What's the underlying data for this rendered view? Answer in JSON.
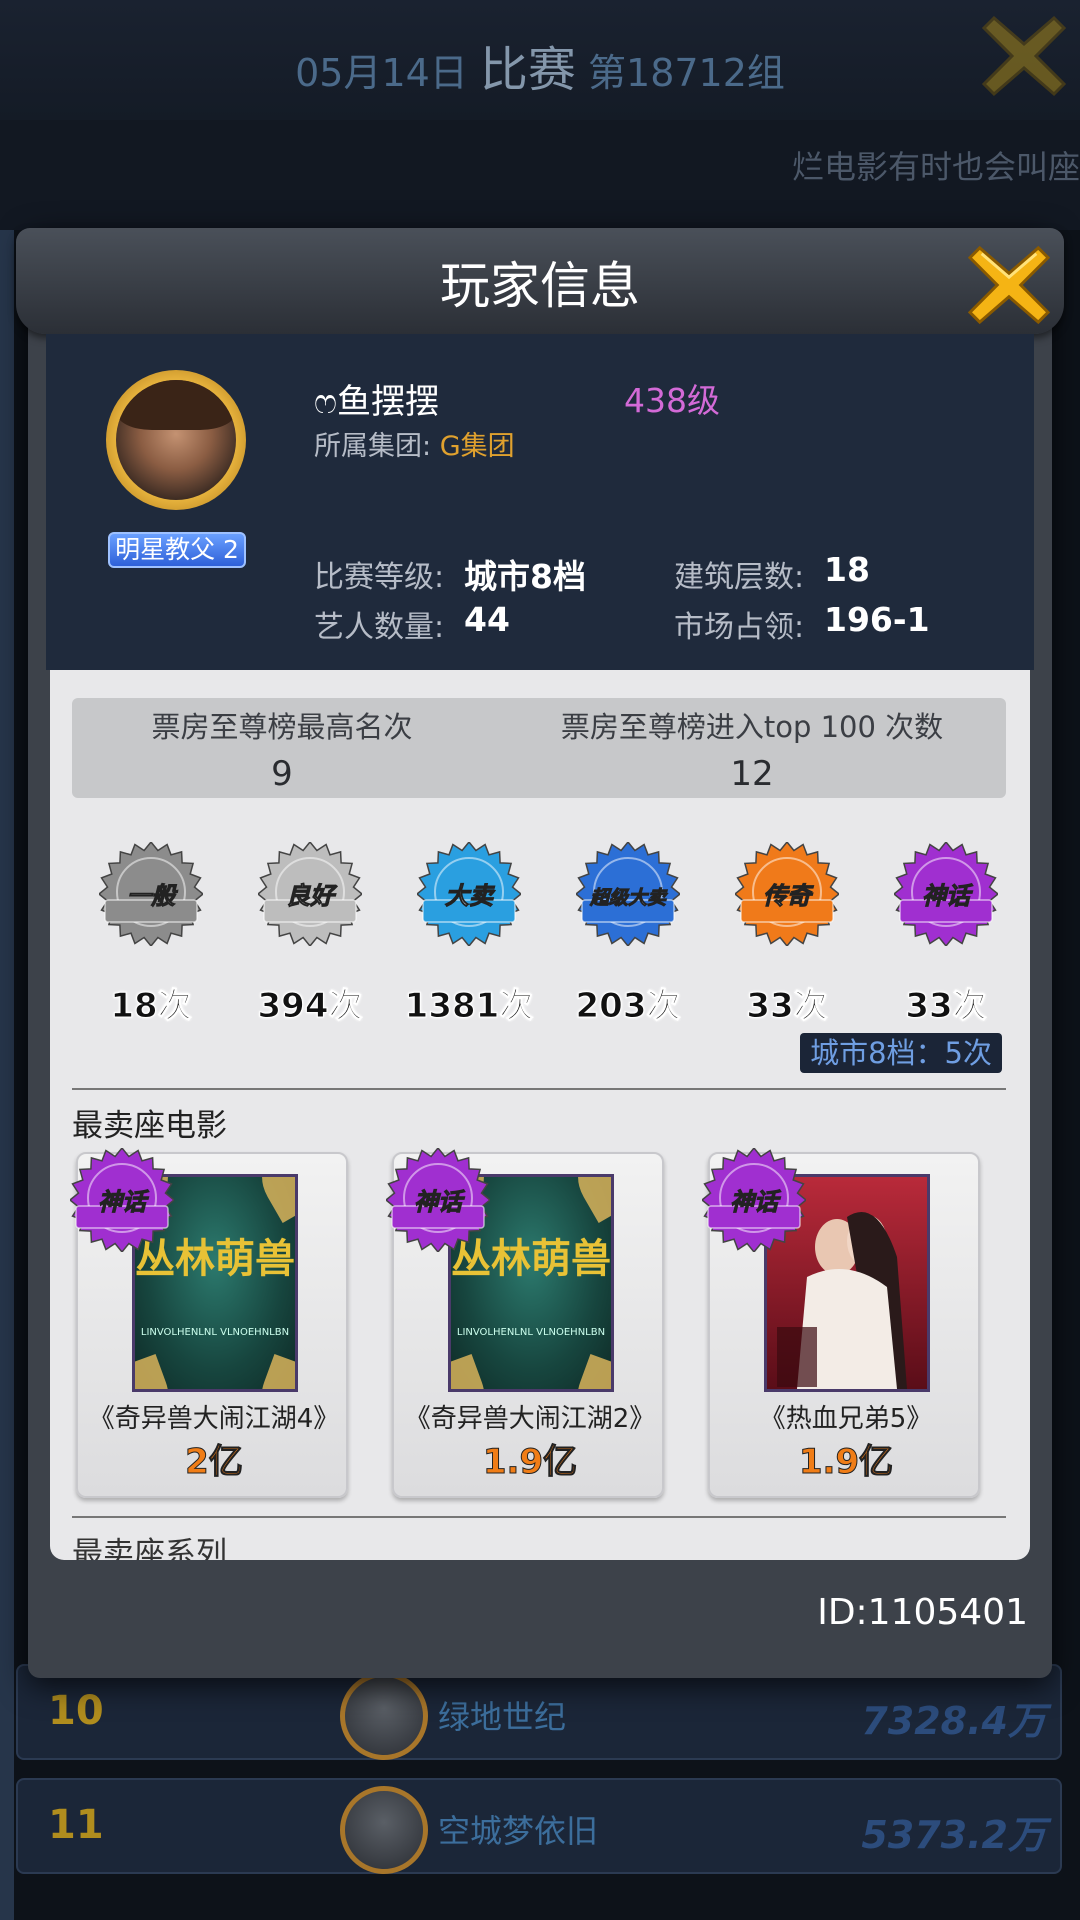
{
  "background": {
    "header_date": "05月14日",
    "header_title": "比赛",
    "header_group": "第18712组",
    "ticker": "烂电影有时也会叫座",
    "rows": [
      {
        "rank": "10",
        "name": "绿地世纪",
        "value": "7328.4万"
      },
      {
        "rank": "11",
        "name": "空城梦依旧",
        "value": "5373.2万"
      }
    ]
  },
  "modal": {
    "title": "玩家信息",
    "player": {
      "name": "ෆ鱼摆摆",
      "level": "438级",
      "group_label": "所属集团:",
      "group_value": "G集团",
      "badge": "明星教父 2",
      "stats": {
        "match_level_label": "比赛等级:",
        "match_level_value": "城市8档",
        "building_label": "建筑层数:",
        "building_value": "18",
        "artists_label": "艺人数量:",
        "artists_value": "44",
        "market_label": "市场占领:",
        "market_value": "196-1"
      }
    },
    "ranking": {
      "best_rank_label": "票房至尊榜最高名次",
      "best_rank_value": "9",
      "top100_label": "票房至尊榜进入top 100 次数",
      "top100_value": "12"
    },
    "medals": [
      {
        "name": "一般",
        "count": "18次",
        "color": "#8c8c8c"
      },
      {
        "name": "良好",
        "count": "394次",
        "color": "#bdbdbd"
      },
      {
        "name": "大卖",
        "count": "1381次",
        "color": "#2a9fe0"
      },
      {
        "name": "超级大卖",
        "count": "203次",
        "color": "#2c6fd6"
      },
      {
        "name": "传奇",
        "count": "33次",
        "color": "#f07a1a"
      },
      {
        "name": "神话",
        "count": "33次",
        "color": "#a02fd0"
      }
    ],
    "city_chip": "城市8档：5次",
    "best_films_title": "最卖座电影",
    "films": [
      {
        "title": "《奇异兽大闹江湖4》",
        "value": "2亿",
        "poster_text": "丛林萌兽",
        "poster_sub": "LINVOLHENLNL VLNOEHNLBN",
        "badge": "神话"
      },
      {
        "title": "《奇异兽大闹江湖2》",
        "value": "1.9亿",
        "poster_text": "丛林萌兽",
        "poster_sub": "LINVOLHENLNL VLNOEHNLBN",
        "badge": "神话"
      },
      {
        "title": "《热血兄弟5》",
        "value": "1.9亿",
        "poster_text": "",
        "poster_sub": "",
        "badge": "神话"
      }
    ],
    "next_section_title": "最卖座系列",
    "player_id": "ID:1105401"
  }
}
